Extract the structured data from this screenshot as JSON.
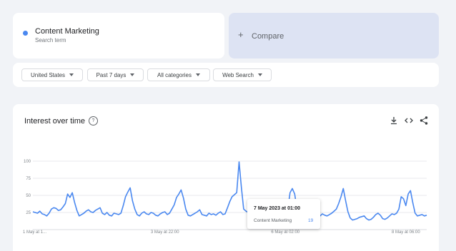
{
  "search_term": {
    "name": "Content Marketing",
    "sublabel": "Search term",
    "color": "#4a88f0"
  },
  "compare": {
    "label": "Compare",
    "icon": "plus-icon"
  },
  "filters": [
    {
      "label": "United States"
    },
    {
      "label": "Past 7 days"
    },
    {
      "label": "All categories"
    },
    {
      "label": "Web Search"
    }
  ],
  "chart_section": {
    "title": "Interest over time",
    "help_icon": "help-icon",
    "actions": [
      "download-icon",
      "embed-code-icon",
      "share-icon"
    ]
  },
  "tooltip": {
    "date": "7 May 2023 at 01:00",
    "term": "Content Marketing",
    "value": "19"
  },
  "chart_data": {
    "type": "line",
    "title": "",
    "xlabel": "",
    "ylabel": "",
    "ylim": [
      0,
      100
    ],
    "y_ticks": [
      100,
      75,
      50,
      25
    ],
    "x_ticks": [
      {
        "label": "1 May at 1...",
        "index": 0
      },
      {
        "label": "3 May at 22:00",
        "index": 57
      },
      {
        "label": "6 May at 02:00",
        "index": 109
      },
      {
        "label": "8 May at 06:00",
        "index": 161
      }
    ],
    "grid": true,
    "series": [
      {
        "name": "Content Marketing",
        "color": "#4a88f0",
        "values": [
          26,
          25,
          24,
          27,
          23,
          22,
          20,
          24,
          30,
          32,
          31,
          28,
          29,
          33,
          38,
          52,
          47,
          54,
          40,
          28,
          20,
          22,
          24,
          27,
          29,
          26,
          25,
          28,
          30,
          32,
          24,
          22,
          25,
          21,
          20,
          24,
          23,
          22,
          24,
          35,
          48,
          55,
          61,
          42,
          30,
          22,
          20,
          24,
          26,
          23,
          22,
          25,
          24,
          21,
          20,
          23,
          25,
          26,
          22,
          24,
          30,
          36,
          47,
          52,
          58,
          46,
          30,
          21,
          20,
          22,
          24,
          26,
          29,
          22,
          21,
          20,
          24,
          22,
          23,
          21,
          24,
          26,
          22,
          23,
          32,
          41,
          48,
          51,
          54,
          99,
          62,
          30,
          27,
          25,
          24,
          22,
          23,
          25,
          22,
          20,
          23,
          24,
          21,
          22,
          25,
          27,
          24,
          21,
          22,
          24,
          28,
          54,
          60,
          52,
          30,
          22,
          20,
          21,
          22,
          24,
          23,
          21,
          19,
          18,
          20,
          23,
          21,
          20,
          22,
          24,
          27,
          30,
          38,
          48,
          60,
          42,
          26,
          17,
          14,
          15,
          16,
          18,
          19,
          20,
          16,
          14,
          15,
          18,
          22,
          24,
          21,
          16,
          15,
          17,
          20,
          23,
          22,
          24,
          30,
          48,
          45,
          35,
          52,
          57,
          39,
          24,
          20,
          21,
          22,
          20,
          21
        ]
      }
    ]
  }
}
